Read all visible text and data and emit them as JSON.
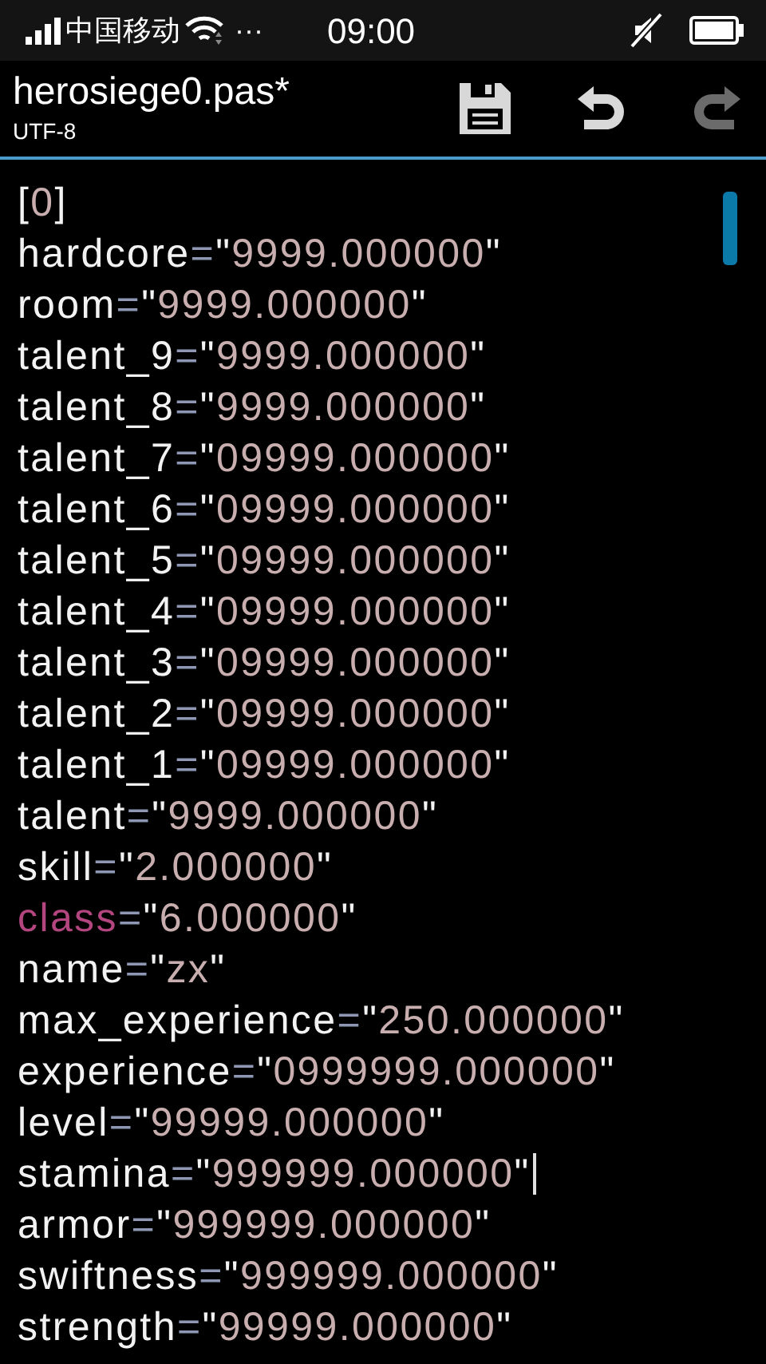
{
  "status_bar": {
    "carrier": "中国移动",
    "more": "···",
    "time": "09:00"
  },
  "header": {
    "title": "herosiege0.pas*",
    "encoding": "UTF-8",
    "actions": [
      {
        "kind": "save",
        "disabled": false
      },
      {
        "kind": "undo",
        "disabled": false
      },
      {
        "kind": "redo",
        "disabled": true
      }
    ]
  },
  "editor": {
    "lines": [
      {
        "kind": "section",
        "open": "[",
        "index": "0",
        "close": "]",
        "cursor": false
      },
      {
        "kind": "assignment",
        "key": "hardcore",
        "keyword": false,
        "op": "=",
        "open_quote": "\"",
        "value": "9999.000000",
        "close_quote": "\"",
        "cursor": false
      },
      {
        "kind": "assignment",
        "key": "room",
        "keyword": false,
        "op": "=",
        "open_quote": "\"",
        "value": "9999.000000",
        "close_quote": "\"",
        "cursor": false
      },
      {
        "kind": "assignment",
        "key": "talent_9",
        "keyword": false,
        "op": "=",
        "open_quote": "\"",
        "value": "9999.000000",
        "close_quote": "\"",
        "cursor": false
      },
      {
        "kind": "assignment",
        "key": "talent_8",
        "keyword": false,
        "op": "=",
        "open_quote": "\"",
        "value": "9999.000000",
        "close_quote": "\"",
        "cursor": false
      },
      {
        "kind": "assignment",
        "key": "talent_7",
        "keyword": false,
        "op": "=",
        "open_quote": "\"",
        "value": "09999.000000",
        "close_quote": "\"",
        "cursor": false
      },
      {
        "kind": "assignment",
        "key": "talent_6",
        "keyword": false,
        "op": "=",
        "open_quote": "\"",
        "value": "09999.000000",
        "close_quote": "\"",
        "cursor": false
      },
      {
        "kind": "assignment",
        "key": "talent_5",
        "keyword": false,
        "op": "=",
        "open_quote": "\"",
        "value": "09999.000000",
        "close_quote": "\"",
        "cursor": false
      },
      {
        "kind": "assignment",
        "key": "talent_4",
        "keyword": false,
        "op": "=",
        "open_quote": "\"",
        "value": "09999.000000",
        "close_quote": "\"",
        "cursor": false
      },
      {
        "kind": "assignment",
        "key": "talent_3",
        "keyword": false,
        "op": "=",
        "open_quote": "\"",
        "value": "09999.000000",
        "close_quote": "\"",
        "cursor": false
      },
      {
        "kind": "assignment",
        "key": "talent_2",
        "keyword": false,
        "op": "=",
        "open_quote": "\"",
        "value": "09999.000000",
        "close_quote": "\"",
        "cursor": false
      },
      {
        "kind": "assignment",
        "key": "talent_1",
        "keyword": false,
        "op": "=",
        "open_quote": "\"",
        "value": "09999.000000",
        "close_quote": "\"",
        "cursor": false
      },
      {
        "kind": "assignment",
        "key": "talent",
        "keyword": false,
        "op": "=",
        "open_quote": "\"",
        "value": "9999.000000",
        "close_quote": "\"",
        "cursor": false
      },
      {
        "kind": "assignment",
        "key": "skill",
        "keyword": false,
        "op": "=",
        "open_quote": "\"",
        "value": "2.000000",
        "close_quote": "\"",
        "cursor": false
      },
      {
        "kind": "assignment",
        "key": "class",
        "keyword": true,
        "op": "=",
        "open_quote": "\"",
        "value": "6.000000",
        "close_quote": "\"",
        "cursor": false
      },
      {
        "kind": "assignment",
        "key": "name",
        "keyword": false,
        "op": "=",
        "open_quote": "\"",
        "value": "zx",
        "close_quote": "\"",
        "cursor": false
      },
      {
        "kind": "assignment",
        "key": "max_experience",
        "keyword": false,
        "op": "=",
        "open_quote": "\"",
        "value": "250.000000",
        "close_quote": "\"",
        "cursor": false
      },
      {
        "kind": "assignment",
        "key": "experience",
        "keyword": false,
        "op": "=",
        "open_quote": "\"",
        "value": "0999999.000000",
        "close_quote": "\"",
        "cursor": false
      },
      {
        "kind": "assignment",
        "key": "level",
        "keyword": false,
        "op": "=",
        "open_quote": "\"",
        "value": "99999.000000",
        "close_quote": "\"",
        "cursor": false
      },
      {
        "kind": "assignment",
        "key": "stamina",
        "keyword": false,
        "op": "=",
        "open_quote": "\"",
        "value": "999999.000000",
        "close_quote": "\"",
        "cursor": true
      },
      {
        "kind": "assignment",
        "key": "armor",
        "keyword": false,
        "op": "=",
        "open_quote": "\"",
        "value": "999999.000000",
        "close_quote": "\"",
        "cursor": false
      },
      {
        "kind": "assignment",
        "key": "swiftness",
        "keyword": false,
        "op": "=",
        "open_quote": "\"",
        "value": "999999.000000",
        "close_quote": "\"",
        "cursor": false
      },
      {
        "kind": "assignment",
        "key": "strength",
        "keyword": false,
        "op": "=",
        "open_quote": "\"",
        "value": "99999.000000",
        "close_quote": "\"",
        "cursor": false
      }
    ]
  }
}
